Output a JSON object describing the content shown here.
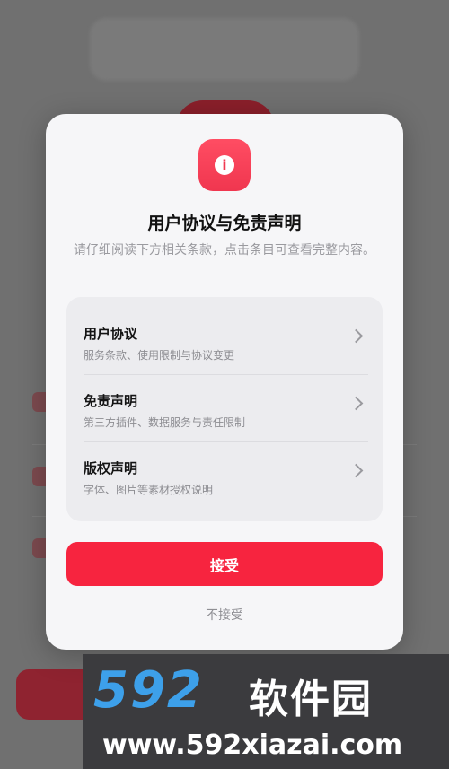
{
  "dialog": {
    "title": "用户协议与免责声明",
    "subtitle": "请仔细阅读下方相关条款，点击条目可查看完整内容。",
    "items": [
      {
        "title": "用户协议",
        "desc": "服务条款、使用限制与协议变更"
      },
      {
        "title": "免责声明",
        "desc": "第三方插件、数据服务与责任限制"
      },
      {
        "title": "版权声明",
        "desc": "字体、图片等素材授权说明"
      }
    ],
    "accept_label": "接受",
    "decline_label": "不接受",
    "badge_icon": "info-icon"
  },
  "watermark": {
    "logo": "592",
    "name": "软件园",
    "url": "www.592xiazai.com"
  },
  "colors": {
    "accent": "#f7243f",
    "overlay": "#707070",
    "dialog_bg": "#f6f6f8"
  }
}
